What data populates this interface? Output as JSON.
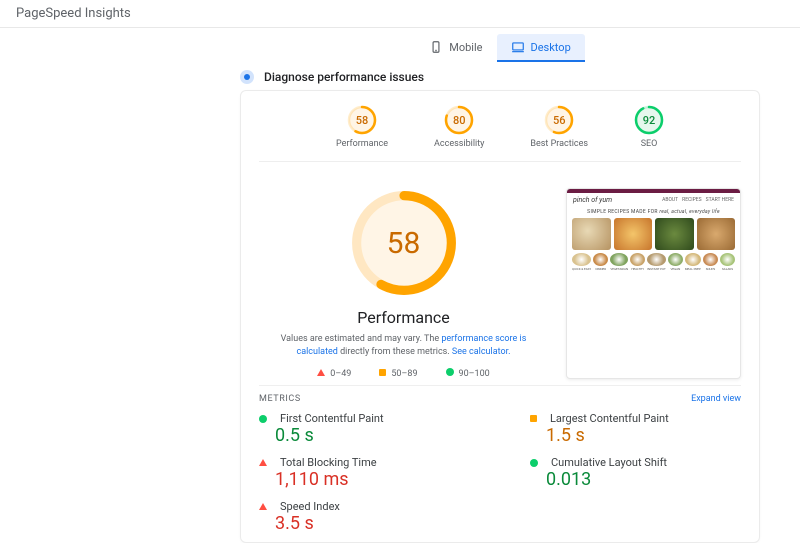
{
  "header": {
    "title": "PageSpeed Insights"
  },
  "tabs": {
    "mobile": "Mobile",
    "desktop": "Desktop",
    "active": "desktop"
  },
  "diagnose_label": "Diagnose performance issues",
  "scores": [
    {
      "value": 58,
      "label": "Performance",
      "status": "avg"
    },
    {
      "value": 80,
      "label": "Accessibility",
      "status": "avg"
    },
    {
      "value": 56,
      "label": "Best Practices",
      "status": "avg"
    },
    {
      "value": 92,
      "label": "SEO",
      "status": "good"
    }
  ],
  "big": {
    "score": 58,
    "title": "Performance",
    "note_pre": "Values are estimated and may vary. The ",
    "note_link1": "performance score is calculated",
    "note_mid": " directly from these metrics. ",
    "note_link2": "See calculator."
  },
  "legend": {
    "low": "0–49",
    "mid": "50–89",
    "high": "90–100"
  },
  "thumbnail": {
    "logo": "pinch of yum",
    "nav": [
      "ABOUT",
      "RECIPES",
      "START HERE"
    ],
    "headline_pre": "SIMPLE RECIPES MADE FOR",
    "headline_em": "real, actual, everyday life",
    "chips": [
      "QUICK & EASY",
      "DINNER",
      "VEGETARIAN",
      "HEALTHY",
      "INSTANT POT",
      "VEGAN",
      "MEAL PREP",
      "SOUPS",
      "SALADS"
    ]
  },
  "metrics": {
    "heading": "METRICS",
    "expand": "Expand view",
    "items": [
      {
        "name": "First Contentful Paint",
        "value": "0.5 s",
        "status": "good"
      },
      {
        "name": "Largest Contentful Paint",
        "value": "1.5 s",
        "status": "avg"
      },
      {
        "name": "Total Blocking Time",
        "value": "1,110 ms",
        "status": "bad"
      },
      {
        "name": "Cumulative Layout Shift",
        "value": "0.013",
        "status": "good"
      },
      {
        "name": "Speed Index",
        "value": "3.5 s",
        "status": "bad"
      }
    ]
  },
  "colors": {
    "good": "#0cce6b",
    "avg": "#ffa400",
    "bad": "#ff4e42",
    "good_text": "#0a8a3a",
    "avg_text": "#c96a00",
    "bad_text": "#d93025"
  }
}
